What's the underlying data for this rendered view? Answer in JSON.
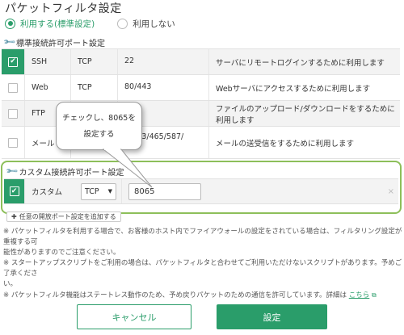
{
  "page": {
    "title": "パケットフィルタ設定"
  },
  "radio": {
    "option_on": "利用する(標準設定)",
    "option_off": "利用しない"
  },
  "standard_section": {
    "label": "標準接続許可ポート設定",
    "rows": [
      {
        "checked": true,
        "name": "SSH",
        "protocol": "TCP",
        "port": "22",
        "description": "サーバにリモートログインするために利用します"
      },
      {
        "checked": false,
        "name": "Web",
        "protocol": "TCP",
        "port": "80/443",
        "description": "Webサーバにアクセスするために利用します"
      },
      {
        "checked": false,
        "name": "FTP",
        "protocol": "",
        "port": "",
        "description": "ファイルのアップロード/ダウンロードをするために利用します"
      },
      {
        "checked": false,
        "name": "メール",
        "protocol": "",
        "port": "0/143/465/587/",
        "port2": "5",
        "description": "メールの送受信をするために利用します"
      }
    ]
  },
  "custom_section": {
    "label": "カスタム接続許可ポート設定",
    "row": {
      "checked": true,
      "name": "カスタム",
      "protocol_selected": "TCP",
      "port_value": "8065",
      "remove_glyph": "×"
    }
  },
  "add_button": {
    "label": "任意の開放ポート設定を追加する"
  },
  "notes": {
    "line1": "※ パケットフィルタを利用する場合で、お客様のホスト内でファイアウォールの設定をされている場合は、フィルタリング設定が重複する可",
    "line1b": "能性がありますのでご注意ください。",
    "line2": "※ スタートアップスクリプトをご利用の場合は、パケットフィルタと合わせてご利用いただけないスクリプトがあります。予めご了承くださ",
    "line2b": "い。",
    "line3": "※ パケットフィルタ機能はステートレス動作のため、予め戻りパケットのための通信を許可しています。詳細は",
    "link": "こちら"
  },
  "buttons": {
    "cancel": "キャンセル",
    "ok": "設定"
  },
  "callout": {
    "line1": "チェックし、8065を",
    "line2": "設定する"
  },
  "colors": {
    "accent": "#2a9d6a",
    "highlight_border": "#8dbf5a"
  },
  "icons": {
    "wrench": "wrench-icon",
    "check": "check-icon",
    "dropdown": "chevron-down-icon",
    "external_link": "external-link-icon",
    "plus": "plus-icon"
  }
}
